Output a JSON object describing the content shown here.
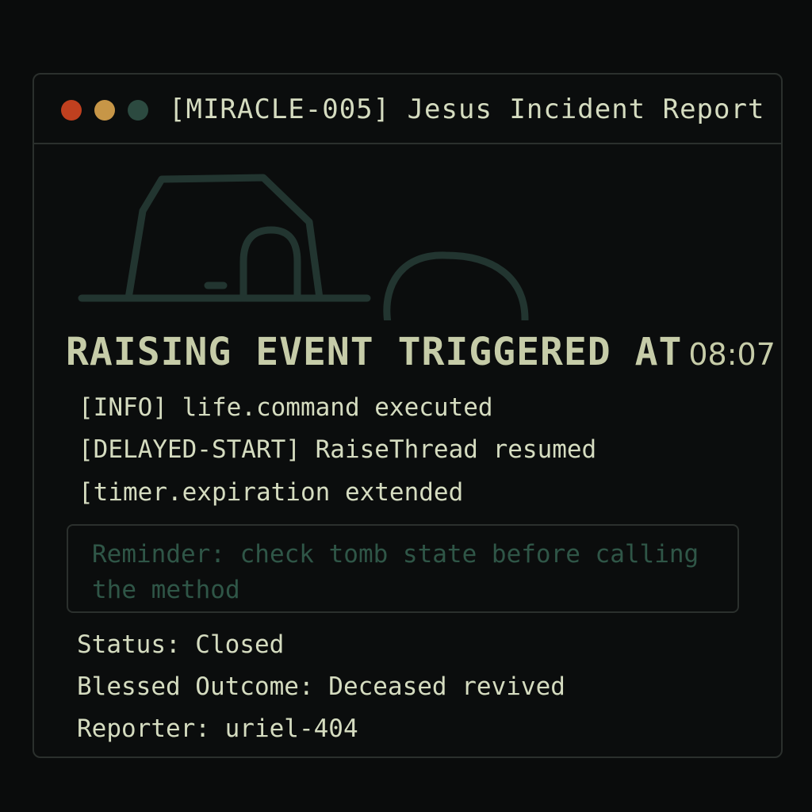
{
  "window": {
    "title": "[MIRACLE-005] Jesus Incident Report",
    "controls": {
      "close_color": "#c0401f",
      "minimize_color": "#c79647",
      "maximize_color": "#2c4a40"
    }
  },
  "illustration": {
    "icons": [
      "tomb-icon",
      "stone-icon"
    ]
  },
  "headline": {
    "text": "RAISING EVENT TRIGGERED AT",
    "time": "08:07"
  },
  "log": [
    "[INFO] life.command executed",
    "[DELAYED-START] RaiseThread resumed",
    "[timer.expiration extended"
  ],
  "reminder": "Reminder: check tomb state before calling the method",
  "meta": {
    "status": "Status: Closed",
    "outcome": "Blessed Outcome: Deceased revived",
    "reporter": "Reporter: uriel-404"
  }
}
